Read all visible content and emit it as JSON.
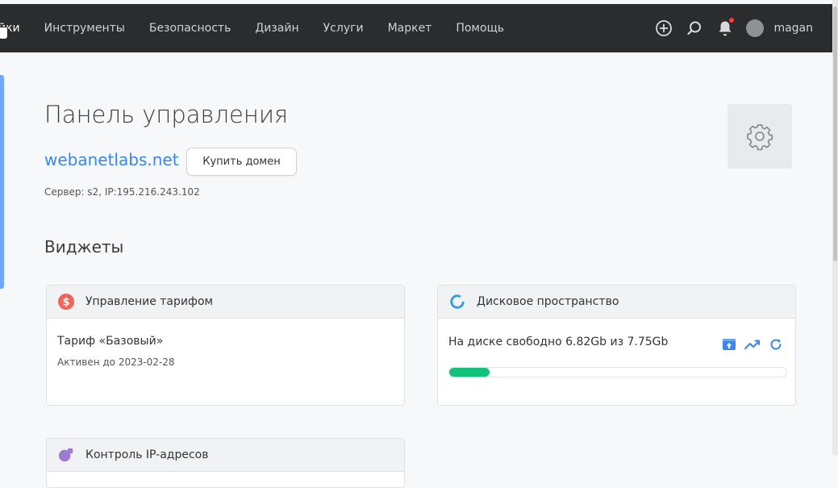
{
  "nav": {
    "items": [
      "йки",
      "Инструменты",
      "Безопасность",
      "Дизайн",
      "Услуги",
      "Маркет",
      "Помощь"
    ]
  },
  "topbar": {
    "username": "magan",
    "icons": [
      "plus-circle-icon",
      "search-icon",
      "bell-icon",
      "avatar"
    ],
    "bell_badge_color": "#ff3b3b"
  },
  "page": {
    "title": "Панель управления",
    "domain": "webanetlabs.net",
    "buy_domain_label": "Купить домен",
    "server_info": "Сервер: s2, IP:195.216.243.102",
    "widgets_title": "Виджеты"
  },
  "widgets": {
    "tariff": {
      "title": "Управление тарифом",
      "name": "Тариф «Базовый»",
      "active_until": "Активен до 2023-02-28"
    },
    "disk": {
      "title": "Дисковое пространство",
      "free_text": "На диске свободно 6.82Gb из 7.75Gb",
      "used_fraction": 0.12,
      "actions": [
        "archive-icon",
        "chart-trend-icon",
        "refresh-icon"
      ]
    },
    "ip": {
      "title": "Контроль IP-адресов"
    }
  },
  "colors": {
    "accent": "#3a86e8",
    "progress": "#12c27a",
    "topbar": "#2b2c2e"
  }
}
